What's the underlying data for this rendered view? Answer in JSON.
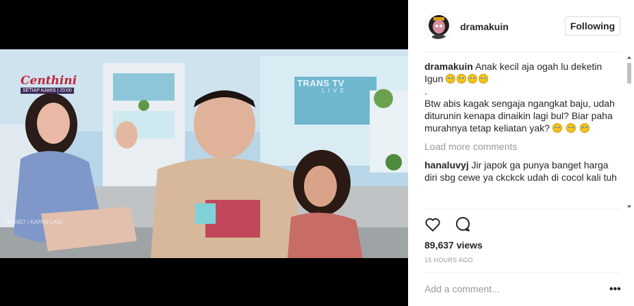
{
  "post": {
    "username": "dramakuin",
    "follow_label": "Following"
  },
  "video": {
    "show_logo": "Centhini",
    "show_sub": "SETIAP KAMIS | 20:00",
    "channel_logo": "TRANS TV",
    "channel_live": "LIVE",
    "watermark": "TRANS7 / KAPAN LAGI"
  },
  "caption": {
    "username": "dramakuin",
    "line1": "Anak kecil aja ogah lu deketin Igun",
    "dot": ".",
    "line2": "Btw abis kagak sengaja ngangkat baju, udah diturunin kenapa dinaikin lagi bul? Biar paha murahnya tetap keliatan yak?"
  },
  "load_more": "Load more comments",
  "comments": [
    {
      "username": "hanaluvyj",
      "text": "Jir japok ga punya banget harga diri sbg cewe ya ckckck udah di cocol kali tuh"
    }
  ],
  "actions": {
    "like_icon": "heart-icon",
    "comment_icon": "comment-bubble-icon"
  },
  "views": "89,637 views",
  "timestamp": "15 HOURS AGO",
  "add_comment_placeholder": "Add a comment...",
  "more_label": "•••"
}
